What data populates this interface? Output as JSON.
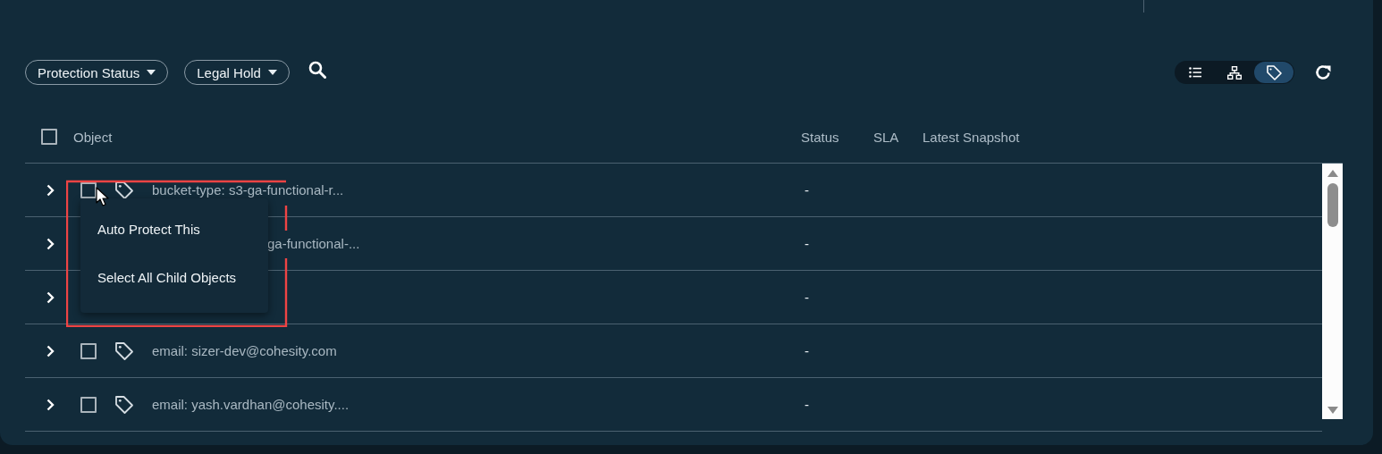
{
  "filters": [
    {
      "label": "Protection Status"
    },
    {
      "label": "Legal Hold"
    }
  ],
  "view_toggle": [
    {
      "kind": "list",
      "selected": false
    },
    {
      "kind": "tree",
      "selected": false
    },
    {
      "kind": "tag",
      "selected": true
    }
  ],
  "table": {
    "select_all_checked": false,
    "columns": [
      "Object",
      "Status",
      "SLA",
      "Latest Snapshot"
    ],
    "rows": [
      {
        "name": "bucket-type: s3-ga-functional-r...",
        "checked": false,
        "status": "-"
      },
      {
        "name": "ga-functional-...",
        "status": "-"
      },
      {
        "status": "-"
      },
      {
        "name": "email: sizer-dev@cohesity.com",
        "checked": false,
        "status": "-"
      },
      {
        "name": "email: yash.vardhan@cohesity....",
        "checked": false,
        "status": "-"
      }
    ]
  },
  "context_menu": {
    "items": [
      "Auto Protect This",
      "Select All Child Objects"
    ]
  }
}
